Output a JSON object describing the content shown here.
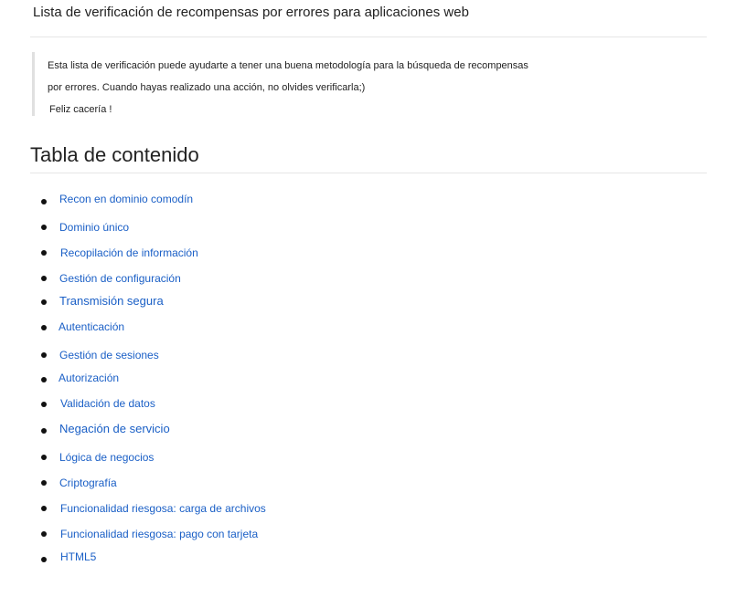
{
  "header": {
    "title": "Lista de verificación de recompensas por errores para aplicaciones web"
  },
  "intro": {
    "line1": "Esta lista de verificación puede ayudarte a tener una buena metodología para la búsqueda de recompensas",
    "line2": "por errores. Cuando hayas realizado una acción, no olvides verificarla;)",
    "line3": "Feliz cacería !"
  },
  "toc": {
    "heading": "Tabla de contenido",
    "items": [
      {
        "label": "Recon en dominio comodín"
      },
      {
        "label": "Dominio único"
      },
      {
        "label": "Recopilación de información"
      },
      {
        "label": "Gestión de configuración"
      },
      {
        "label": "Transmisión segura"
      },
      {
        "label": "Autenticación"
      },
      {
        "label": "Gestión de sesiones"
      },
      {
        "label": "Autorización"
      },
      {
        "label": "Validación de datos"
      },
      {
        "label": "Negación de servicio"
      },
      {
        "label": "Lógica de negocios"
      },
      {
        "label": "Criptografía"
      },
      {
        "label": "Funcionalidad riesgosa: carga de archivos"
      },
      {
        "label": "Funcionalidad riesgosa: pago con tarjeta"
      },
      {
        "label": "HTML5"
      }
    ]
  },
  "colors": {
    "link": "#1a5fc6",
    "text": "#222222",
    "rule": "#e6e6e6"
  }
}
